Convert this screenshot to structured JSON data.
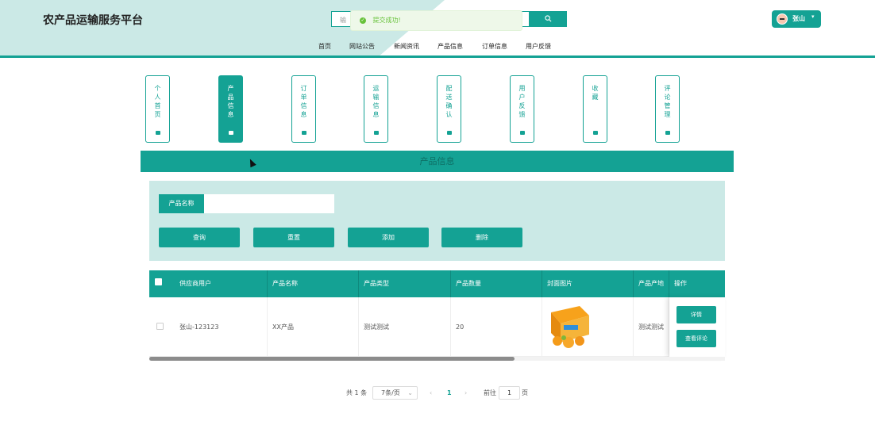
{
  "header": {
    "site_title": "农产品运输服务平台",
    "search_placeholder": "输",
    "search_icon": "search-icon",
    "toast": {
      "text": "提交成功!",
      "icon": "check-circle-icon"
    },
    "user": {
      "name": "张山",
      "caret": "▾"
    }
  },
  "nav": [
    "首页",
    "网站公告",
    "新闻资讯",
    "产品信息",
    "订单信息",
    "用户反馈"
  ],
  "side_tabs": [
    {
      "label": "个人首页",
      "active": false
    },
    {
      "label": "产品信息",
      "active": true
    },
    {
      "label": "订单信息",
      "active": false
    },
    {
      "label": "运输信息",
      "active": false
    },
    {
      "label": "配送确认",
      "active": false
    },
    {
      "label": "用户反馈",
      "active": false
    },
    {
      "label": "收藏",
      "active": false
    },
    {
      "label": "评论管理",
      "active": false
    }
  ],
  "panel": {
    "title": "产品信息"
  },
  "filter": {
    "label": "产品名称",
    "value": ""
  },
  "actions": {
    "query": "查询",
    "reset": "重置",
    "add": "添加",
    "delete": "删除"
  },
  "table": {
    "columns": [
      "供应商用户",
      "产品名称",
      "产品类型",
      "产品数量",
      "封面图片",
      "产品产地",
      "操作"
    ],
    "rows": [
      {
        "supplier": "张山-123123",
        "name": "XX产品",
        "type": "测试测试",
        "quantity": "20",
        "origin": "测试测试",
        "detail_btn": "详情",
        "review_btn": "查看评论"
      }
    ]
  },
  "pagination": {
    "total": "共 1 条",
    "page_size": "7条/页",
    "prev": "‹",
    "current": "1",
    "next": "›",
    "goto_prefix": "前往",
    "goto_value": "1",
    "goto_suffix": "页"
  },
  "colors": {
    "primary": "#14a294",
    "light": "#cbe9e6",
    "success": "#67c23a"
  }
}
